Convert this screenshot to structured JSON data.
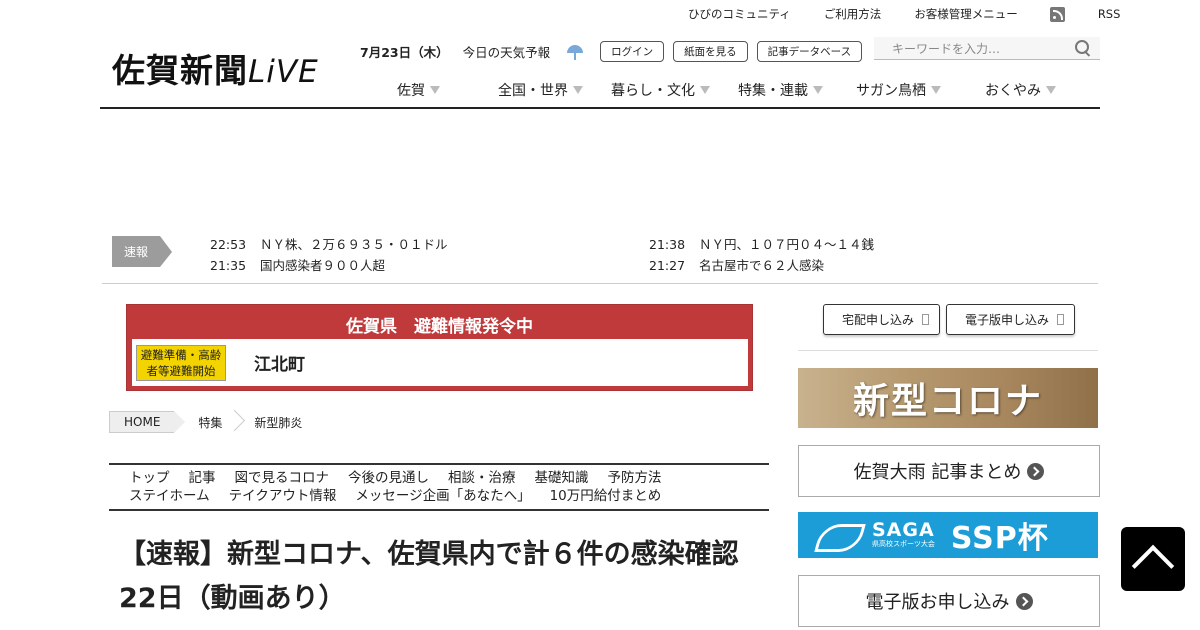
{
  "util_nav": {
    "items": [
      "ひびのコミュニティ",
      "ご利用方法",
      "お客様管理メニュー"
    ],
    "rss": "RSS"
  },
  "logo": {
    "main": "佐賀新聞",
    "live": "LiVE"
  },
  "header": {
    "date": "7月23日（木）",
    "weather_label": "今日の天気予報",
    "login": "ログイン",
    "paper": "紙面を見る",
    "database": "記事データベース"
  },
  "search": {
    "placeholder": "キーワードを入力…"
  },
  "main_nav": [
    "佐賀",
    "全国・世界",
    "暮らし・文化",
    "特集・連載",
    "サガン鳥栖",
    "おくやみ"
  ],
  "breaking": {
    "label": "速報",
    "items": [
      {
        "time": "22:53",
        "text": "ＮＹ株、２万６９３５・０１ドル"
      },
      {
        "time": "21:38",
        "text": "ＮＹ円、１０７円０４～１４銭"
      },
      {
        "time": "21:35",
        "text": "国内感染者９００人超"
      },
      {
        "time": "21:27",
        "text": "名古屋市で６２人感染"
      }
    ]
  },
  "alert": {
    "title": "佐賀県　避難情報発令中",
    "level": "避難準備・高齢者等避難開始",
    "area": "江北町",
    "color": "#c0393b",
    "level_color": "#f4d400"
  },
  "breadcrumb": [
    "HOME",
    "特集",
    "新型肺炎"
  ],
  "subnav": {
    "row1": [
      "トップ",
      "記事",
      "図で見るコロナ",
      "今後の見通し",
      "相談・治療",
      "基礎知識",
      "予防方法"
    ],
    "row2": [
      "ステイホーム",
      "テイクアウト情報",
      "メッセージ企画「あなたへ」",
      "10万円給付まとめ"
    ]
  },
  "headline": "【速報】新型コロナ、佐賀県内で計６件の感染確認　22日（動画あり）",
  "sidebar": {
    "home_delivery": "宅配申し込み",
    "digital_apply": "電子版申し込み",
    "corona_banner": "新型コロナ",
    "rain_summary": "佐賀大雨 記事まとめ",
    "ssp_saga": "SAGA",
    "ssp_sub": "県高校スポーツ大会",
    "ssp_cup": "SSP杯",
    "digital_order": "電子版お申し込み"
  },
  "icons": {
    "rss": "rss-icon",
    "weather": "umbrella-icon",
    "search": "search-icon",
    "back_to_top": "chevron-up-icon"
  }
}
